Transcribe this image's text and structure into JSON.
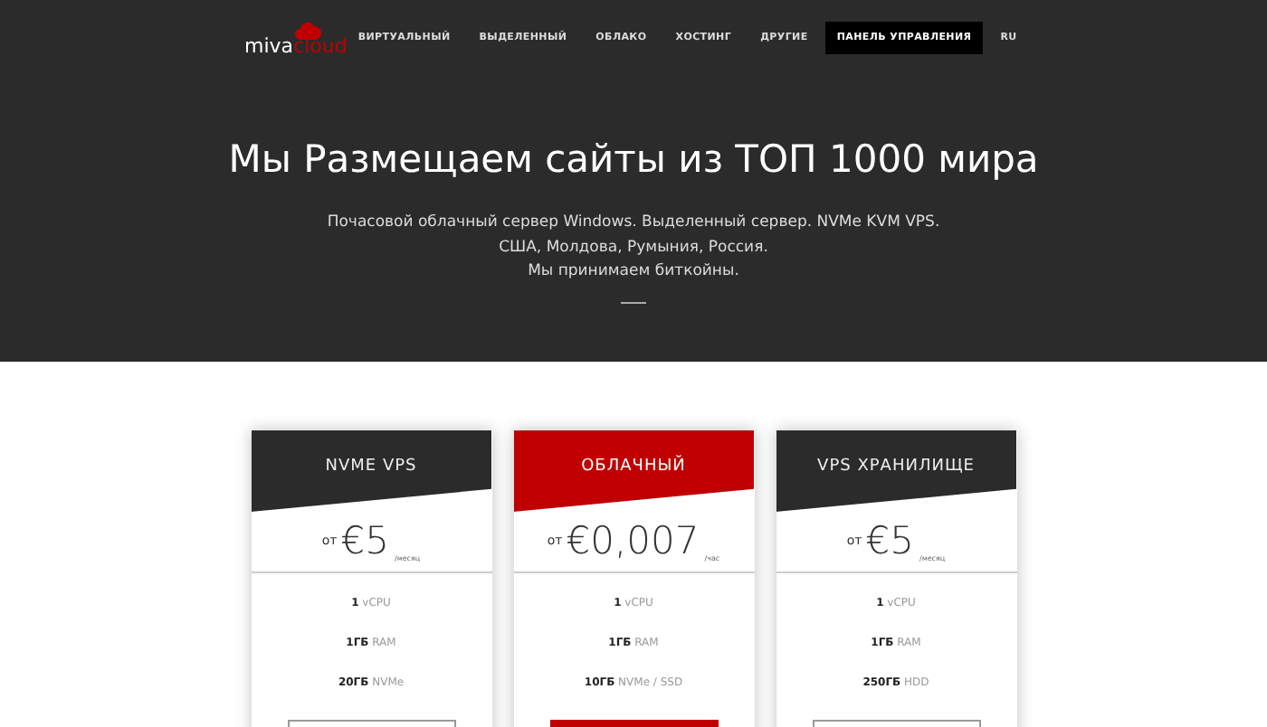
{
  "logo": {
    "part_1": "miva",
    "part_2": "cloud"
  },
  "nav": [
    {
      "label": "ВИРТУАЛЬНЫЙ",
      "selected": false
    },
    {
      "label": "ВЫДЕЛЕННЫЙ",
      "selected": false
    },
    {
      "label": "ОБЛАКО",
      "selected": false
    },
    {
      "label": "ХОСТИНГ",
      "selected": false
    },
    {
      "label": "ДРУГИЕ",
      "selected": false
    },
    {
      "label": "ПАНЕЛЬ УПРАВЛЕНИЯ",
      "selected": true
    },
    {
      "label": "RU",
      "selected": false
    }
  ],
  "hero": {
    "title": "Мы Размещаем сайты из ТОП 1000 мира",
    "lines": [
      "Почасовой облачный сервер Windows. Выделенный сервер. NVMe KVM VPS.",
      "США, Молдова, Румыния, Россия.",
      "Мы принимаем биткойны."
    ]
  },
  "plans": [
    {
      "name": "NVME VPS",
      "highlighted": false,
      "prefix": "от",
      "price": "€5",
      "period": "/месяц",
      "features": [
        {
          "value": "1",
          "unit": "vCPU"
        },
        {
          "value": "1ГБ",
          "unit": "RAM"
        },
        {
          "value": "20ГБ",
          "unit": "NVMe"
        }
      ]
    },
    {
      "name": "ОБЛАЧНЫЙ",
      "highlighted": true,
      "prefix": "от",
      "price": "€0,007",
      "period": "/час",
      "features": [
        {
          "value": "1",
          "unit": "vCPU"
        },
        {
          "value": "1ГБ",
          "unit": "RAM"
        },
        {
          "value": "10ГБ",
          "unit": "NVMe / SSD"
        }
      ]
    },
    {
      "name": "VPS ХРАНИЛИЩЕ",
      "highlighted": false,
      "prefix": "от",
      "price": "€5",
      "period": "/месяц",
      "features": [
        {
          "value": "1",
          "unit": "vCPU"
        },
        {
          "value": "1ГБ",
          "unit": "RAM"
        },
        {
          "value": "250ГБ",
          "unit": "HDD"
        }
      ]
    }
  ]
}
